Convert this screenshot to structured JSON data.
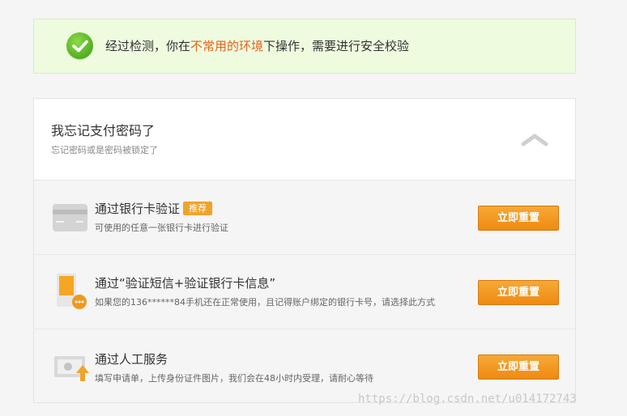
{
  "notice": {
    "text_before": "经过检测，你在",
    "highlight": "不常用的环境",
    "text_after": "下操作，需要进行安全校验"
  },
  "panel": {
    "title": "我忘记支付密码了",
    "subtitle": "忘记密码或是密码被锁定了"
  },
  "options": [
    {
      "title": "通过银行卡验证",
      "badge": "推荐",
      "desc": "可使用的任意一张银行卡进行验证",
      "button": "立即重置",
      "icon": "bank-card-icon"
    },
    {
      "title": "通过“验证短信+验证银行卡信息”",
      "desc": "如果您的136******84手机还在正常使用，且记得账户绑定的银行卡号，请选择此方式",
      "button": "立即重置",
      "icon": "phone-sms-icon"
    },
    {
      "title": "通过人工服务",
      "desc": "填写申请单，上传身份证件图片，我们会在48小时内受理，请耐心等待",
      "button": "立即重置",
      "icon": "id-upload-icon"
    }
  ],
  "watermark": "https://blog.csdn.net/u014172743",
  "colors": {
    "highlight": "#e8621a",
    "button": "#f0981f",
    "badge": "#f0a32b",
    "notice_bg": "#eefbdf"
  }
}
